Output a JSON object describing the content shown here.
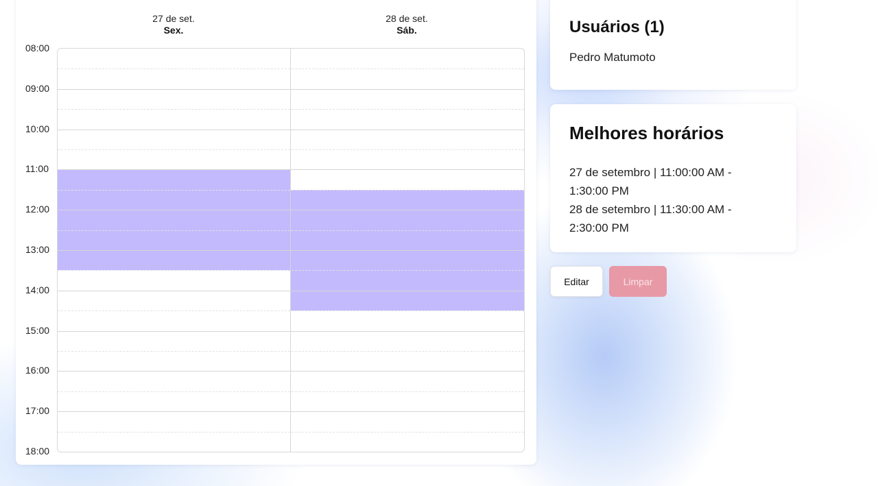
{
  "calendar": {
    "days": [
      {
        "date": "27 de set.",
        "weekday": "Sex."
      },
      {
        "date": "28 de set.",
        "weekday": "Sáb."
      }
    ],
    "times": [
      "08:00",
      "09:00",
      "10:00",
      "11:00",
      "12:00",
      "13:00",
      "14:00",
      "15:00",
      "16:00",
      "17:00",
      "18:00"
    ],
    "slot_interval_minutes": 30,
    "selection_color": "#c3bafd",
    "selected_ranges": [
      {
        "day": "27 de set.",
        "start": "11:00",
        "end": "13:30"
      },
      {
        "day": "28 de set.",
        "start": "11:30",
        "end": "14:30"
      }
    ]
  },
  "users": {
    "title": "Usuários (1)",
    "items": [
      "Pedro Matumoto"
    ]
  },
  "best_times": {
    "title": "Melhores horários",
    "items": [
      "27 de setembro | 11:00:00 AM - 1:30:00 PM",
      "28 de setembro | 11:30:00 AM - 2:30:00 PM"
    ]
  },
  "actions": {
    "edit_label": "Editar",
    "clear_label": "Limpar",
    "clear_color": "#e899a6"
  }
}
